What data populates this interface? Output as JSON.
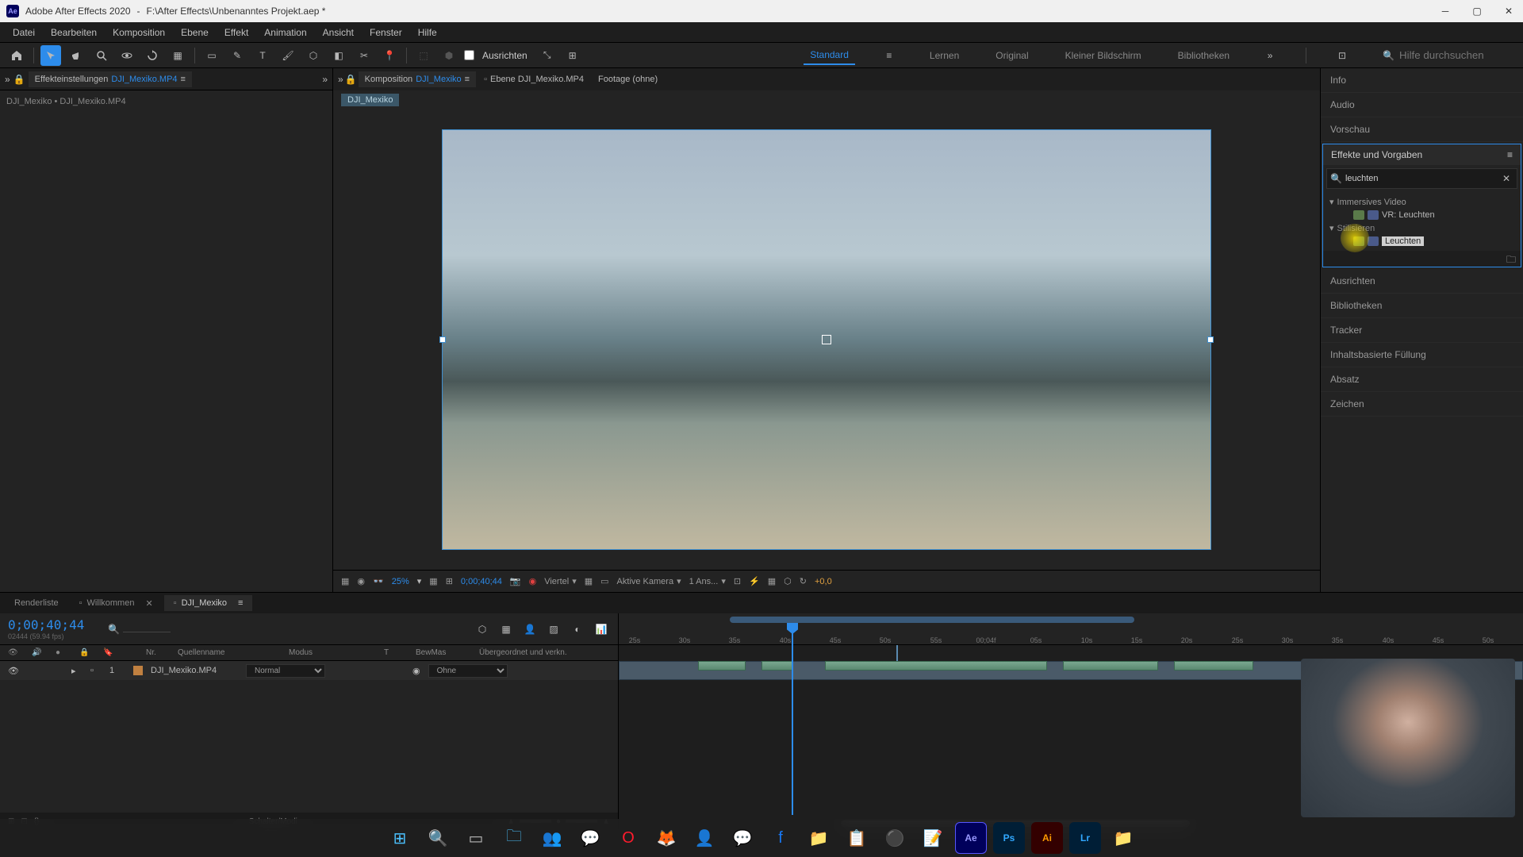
{
  "titlebar": {
    "app": "Adobe After Effects 2020",
    "path": "F:\\After Effects\\Unbenanntes Projekt.aep *"
  },
  "menu": [
    "Datei",
    "Bearbeiten",
    "Komposition",
    "Ebene",
    "Effekt",
    "Animation",
    "Ansicht",
    "Fenster",
    "Hilfe"
  ],
  "toolbar": {
    "ausrichten": "Ausrichten",
    "workspaces": [
      "Standard",
      "Lernen",
      "Original",
      "Kleiner Bildschirm",
      "Bibliotheken"
    ],
    "active_ws": 0,
    "help_placeholder": "Hilfe durchsuchen"
  },
  "left_panel": {
    "tab1_prefix": "Effekteinstellungen",
    "tab1_link": "DJI_Mexiko.MP4",
    "breadcrumb": "DJI_Mexiko • DJI_Mexiko.MP4"
  },
  "center": {
    "tab_comp": "Komposition",
    "tab_comp_link": "DJI_Mexiko",
    "tab_layer": "Ebene DJI_Mexiko.MP4",
    "tab_footage": "Footage (ohne)",
    "comp_name": "DJI_Mexiko"
  },
  "viewer_controls": {
    "zoom": "25%",
    "timecode": "0;00;40;44",
    "quality": "Viertel",
    "camera": "Aktive Kamera",
    "views": "1 Ans...",
    "offset": "+0,0"
  },
  "right_panel": {
    "sections_top": [
      "Info",
      "Audio",
      "Vorschau"
    ],
    "effects_title": "Effekte und Vorgaben",
    "search_value": "leuchten",
    "tree": {
      "cat1": "Immersives Video",
      "item1": "VR: Leuchten",
      "cat2": "Stilisieren",
      "item2": "Leuchten"
    },
    "sections_bottom": [
      "Ausrichten",
      "Bibliotheken",
      "Tracker",
      "Inhaltsbasierte Füllung",
      "Absatz",
      "Zeichen"
    ]
  },
  "timeline": {
    "tabs": [
      "Renderliste",
      "Willkommen",
      "DJI_Mexiko"
    ],
    "timecode": "0;00;40;44",
    "timecode_sub": "02444 (59.94 fps)",
    "headers": {
      "nr": "Nr.",
      "quelle": "Quellenname",
      "modus": "Modus",
      "t": "T",
      "bewmas": "BewMas",
      "ueber": "Übergeordnet und verkn."
    },
    "layer": {
      "num": "1",
      "name": "DJI_Mexiko.MP4",
      "mode": "Normal",
      "parent": "Ohne"
    },
    "ruler_ticks": [
      "25s",
      "30s",
      "35s",
      "40s",
      "45s",
      "50s",
      "55s",
      "00;04f",
      "05s",
      "10s",
      "15s",
      "20s",
      "25s",
      "30s",
      "35s",
      "40s",
      "45s",
      "50s"
    ],
    "footer": "Schalter/Modi"
  }
}
